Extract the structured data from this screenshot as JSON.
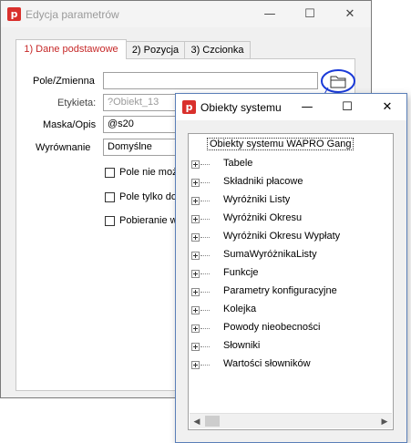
{
  "main_window": {
    "title": "Edycja parametrów",
    "app_icon": "p",
    "controls": {
      "minimize": "—",
      "maximize": "☐",
      "close": "✕"
    },
    "tabs": [
      "1) Dane podstawowe",
      "2) Pozycja",
      "3) Czcionka"
    ],
    "form": {
      "pole_label": "Pole/Zmienna",
      "pole_value": "",
      "etykieta_label": "Etykieta:",
      "etykieta_value": "?Obiekt_13",
      "maska_label": "Maska/Opis",
      "maska_value": "@s20",
      "wyrownanie_label": "Wyrównanie",
      "wyrownanie_value": "Domyślne",
      "checkboxes": [
        "Pole nie może",
        "Pole tylko do",
        "Pobieranie w"
      ]
    }
  },
  "popup_window": {
    "title": "Obiekty systemu",
    "app_icon": "p",
    "controls": {
      "minimize": "—",
      "maximize": "☐",
      "close": "✕"
    },
    "tree_root": "Obiekty systemu WAPRO Gang",
    "tree_items": [
      "Tabele",
      "Składniki płacowe",
      "Wyróżniki Listy",
      "Wyróżniki Okresu",
      "Wyróżniki Okresu Wypłaty",
      "SumaWyróżnikaListy",
      "Funkcje",
      "Parametry konfiguracyjne",
      "Kolejka",
      "Powody nieobecności",
      "Słowniki",
      "Wartości słowników"
    ]
  },
  "colors": {
    "accent_red": "#d9302c",
    "tab_active_text": "#c62828",
    "highlight_circle": "#1a3ad8"
  }
}
